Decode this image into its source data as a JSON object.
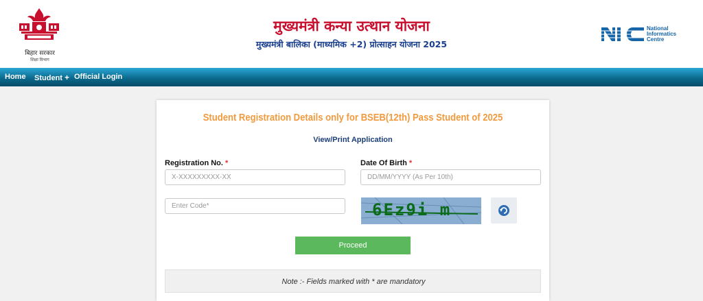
{
  "header": {
    "title": "मुख्यमंत्री कन्या उत्थान योजना",
    "subtitle": "मुख्यमंत्री बालिका (माध्यमिक +2) प्रोत्साहन योजना 2025",
    "gov_name": "बिहार सरकार",
    "gov_sub": "शिक्षा विभाग",
    "nic_line1": "National",
    "nic_line2": "Informatics",
    "nic_line3": "Centre",
    "nic_logo_text": "NIC"
  },
  "nav": {
    "home": "Home",
    "student": "Student",
    "student_plus": "+",
    "official_login": "Official Login"
  },
  "form": {
    "heading": "Student Registration Details only for BSEB(12th) Pass Student of 2025",
    "view_print": "View/Print Application",
    "reg_label": "Registration No.",
    "reg_placeholder": "X-XXXXXXXXX-XX",
    "dob_label": "Date Of Birth",
    "dob_placeholder": "DD/MM/YYYY (As Per 10th)",
    "required_mark": "*",
    "code_placeholder": "Enter Code*",
    "captcha_text": "6Ez9i m",
    "proceed_label": "Proceed",
    "note": "Note :- Fields marked with * are mandatory"
  },
  "colors": {
    "title_red": "#c8102e",
    "subtitle_blue": "#1a3f8f",
    "heading_orange": "#f19a3e",
    "proceed_green": "#5cb85c",
    "nav_blue": "#0c6a8e"
  },
  "icons": {
    "emblem": "bihar-emblem-icon",
    "refresh": "refresh-icon"
  }
}
